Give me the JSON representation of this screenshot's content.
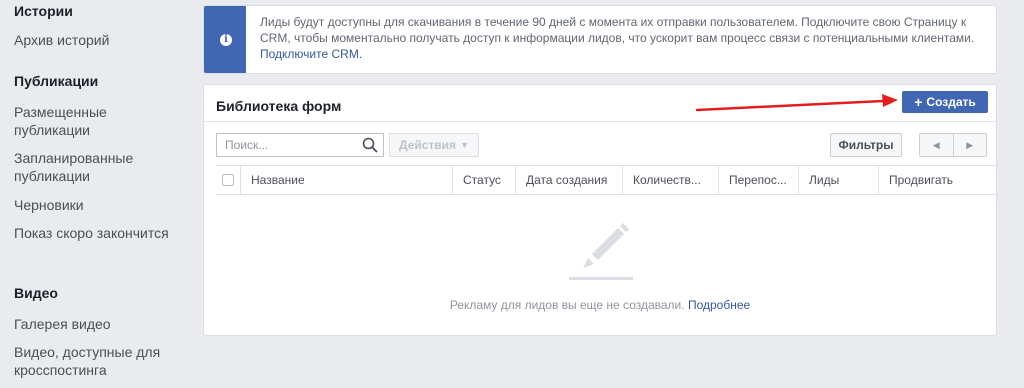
{
  "sidebar": {
    "sections": [
      {
        "heading": "Истории",
        "items": [
          "Архив историй"
        ]
      },
      {
        "heading": "Публикации",
        "items": [
          "Размещенные публикации",
          "Запланированные публикации",
          "Черновики",
          "Показ скоро закончится"
        ]
      },
      {
        "heading": "Видео",
        "items": [
          "Галерея видео",
          "Видео, доступные для кросспостинга"
        ]
      }
    ]
  },
  "banner": {
    "text": "Лиды будут доступны для скачивания в течение 90 дней с момента их отправки пользователем. Подключите свою Страницу к CRM, чтобы моментально получать доступ к информации лидов, что ускорит вам процесс связи с потенциальными клиентами.",
    "link": "Подключите CRM.",
    "accent_color": "#4267b2"
  },
  "forms_library": {
    "title": "Библиотека форм",
    "create_label": "Создать",
    "search_placeholder": "Поиск...",
    "actions_label": "Действия",
    "filters_label": "Фильтры",
    "columns": [
      "Название",
      "Статус",
      "Дата создания",
      "Количеств...",
      "Перепос...",
      "Лиды",
      "Продвигать"
    ],
    "empty_text": "Рекламу для лидов вы еще не создавали.",
    "empty_link": "Подробнее"
  },
  "annotation": {
    "arrow_color": "#e41e1e"
  }
}
